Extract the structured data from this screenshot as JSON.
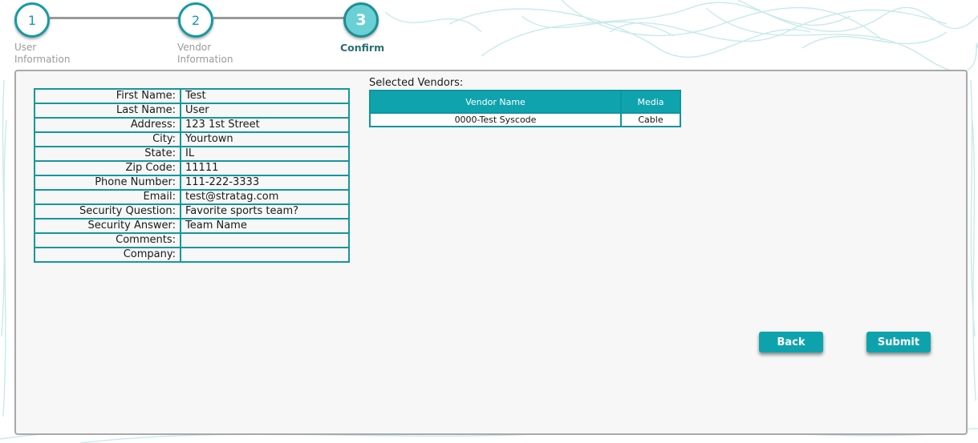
{
  "wizard": {
    "steps": [
      {
        "number": "1",
        "label_line1": "User",
        "label_line2": "Information"
      },
      {
        "number": "2",
        "label_line1": "Vendor",
        "label_line2": "Information"
      },
      {
        "number": "3",
        "label_line1": "Confirm",
        "label_line2": ""
      }
    ],
    "active_step": 3
  },
  "user_info": {
    "rows": [
      {
        "label": "First Name:",
        "value": "Test"
      },
      {
        "label": "Last Name:",
        "value": "User"
      },
      {
        "label": "Address:",
        "value": "123 1st Street"
      },
      {
        "label": "City:",
        "value": "Yourtown"
      },
      {
        "label": "State:",
        "value": "IL"
      },
      {
        "label": "Zip Code:",
        "value": "11111"
      },
      {
        "label": "Phone Number:",
        "value": "111-222-3333"
      },
      {
        "label": "Email:",
        "value": "test@stratag.com"
      },
      {
        "label": "Security Question:",
        "value": "Favorite sports team?"
      },
      {
        "label": "Security Answer:",
        "value": "Team Name"
      },
      {
        "label": "Comments:",
        "value": ""
      },
      {
        "label": "Company:",
        "value": ""
      }
    ]
  },
  "vendors": {
    "title": "Selected Vendors:",
    "columns": [
      "Vendor Name",
      "Media"
    ],
    "rows": [
      {
        "name": "0000-Test Syscode",
        "media": "Cable"
      }
    ]
  },
  "buttons": {
    "back": "Back",
    "submit": "Submit"
  },
  "colors": {
    "accent": "#0ea3ac",
    "border": "#1497a0",
    "panel_bg": "#f7f7f7"
  }
}
